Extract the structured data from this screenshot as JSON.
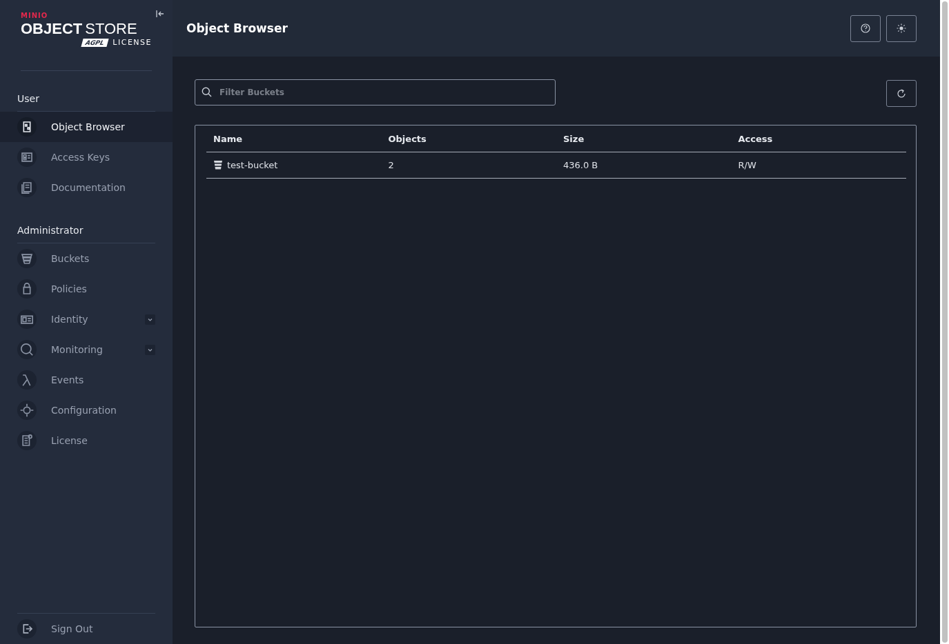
{
  "sidebar": {
    "logo": {
      "brand": "MINIO",
      "product_bold": "OBJECT",
      "product_light": "STORE",
      "badge": "AGPL",
      "license": "LICENSE"
    },
    "sections": [
      {
        "title": "User",
        "items": [
          {
            "label": "Object Browser",
            "selected": true
          },
          {
            "label": "Access Keys",
            "selected": false
          },
          {
            "label": "Documentation",
            "selected": false
          }
        ]
      },
      {
        "title": "Administrator",
        "items": [
          {
            "label": "Buckets",
            "selected": false
          },
          {
            "label": "Policies",
            "selected": false
          },
          {
            "label": "Identity",
            "selected": false,
            "expanded": false
          },
          {
            "label": "Monitoring",
            "selected": false,
            "expanded": false
          },
          {
            "label": "Events",
            "selected": false
          },
          {
            "label": "Configuration",
            "selected": false
          },
          {
            "label": "License",
            "selected": false
          }
        ]
      }
    ],
    "sign_out": "Sign Out"
  },
  "header": {
    "title": "Object Browser"
  },
  "search": {
    "placeholder": "Filter Buckets"
  },
  "table": {
    "columns": [
      "Name",
      "Objects",
      "Size",
      "Access"
    ],
    "rows": [
      {
        "cells": [
          "test-bucket",
          "2",
          "436.0 B",
          "R/W"
        ]
      }
    ]
  }
}
